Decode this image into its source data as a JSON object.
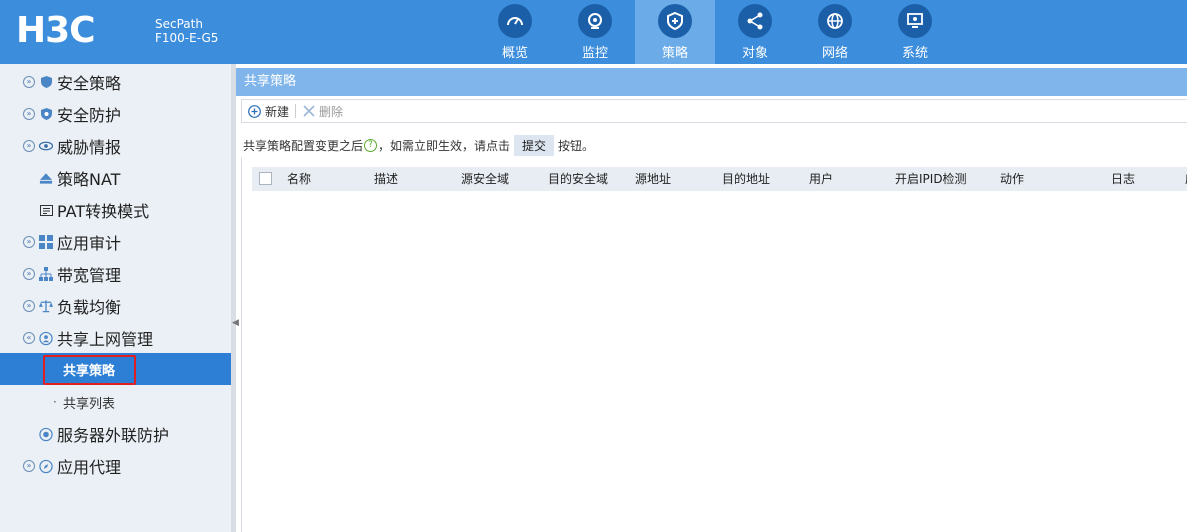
{
  "header": {
    "product_line1": "SecPath",
    "product_line2": "F100-E-G5",
    "nav": [
      {
        "label": "概览",
        "icon": "speedometer-icon"
      },
      {
        "label": "监控",
        "icon": "webcam-icon"
      },
      {
        "label": "策略",
        "icon": "shield-plus-icon",
        "active": true
      },
      {
        "label": "对象",
        "icon": "share-nodes-icon"
      },
      {
        "label": "网络",
        "icon": "globe-icon"
      },
      {
        "label": "系统",
        "icon": "monitor-gear-icon"
      }
    ]
  },
  "sidebar": {
    "items": [
      {
        "label": "安全策略"
      },
      {
        "label": "安全防护"
      },
      {
        "label": "威胁情报"
      },
      {
        "label": "策略NAT"
      },
      {
        "label": "PAT转换模式"
      },
      {
        "label": "应用审计"
      },
      {
        "label": "带宽管理"
      },
      {
        "label": "负载均衡"
      },
      {
        "label": "共享上网管理"
      },
      {
        "label": "共享策略"
      },
      {
        "label": "共享列表"
      },
      {
        "label": "服务器外联防护"
      },
      {
        "label": "应用代理"
      }
    ]
  },
  "content": {
    "title": "共享策略",
    "toolbar": {
      "new_label": "新建",
      "delete_label": "删除"
    },
    "notice": {
      "before": "共享策略配置变更之后",
      "middle": "，如需立即生效，请点击",
      "button": "提交",
      "after": "按钮。"
    },
    "columns": [
      "名称",
      "描述",
      "源安全域",
      "目的安全域",
      "源地址",
      "目的地址",
      "用户",
      "开启IPID检测",
      "动作",
      "日志",
      "应"
    ]
  },
  "colors": {
    "topbar": "#3c8ddc",
    "active_nav": "#6aabe8",
    "sidebar_bg": "#ebf0f6",
    "sidebar_active": "#2d7fd6",
    "highlight": "#e02020"
  }
}
